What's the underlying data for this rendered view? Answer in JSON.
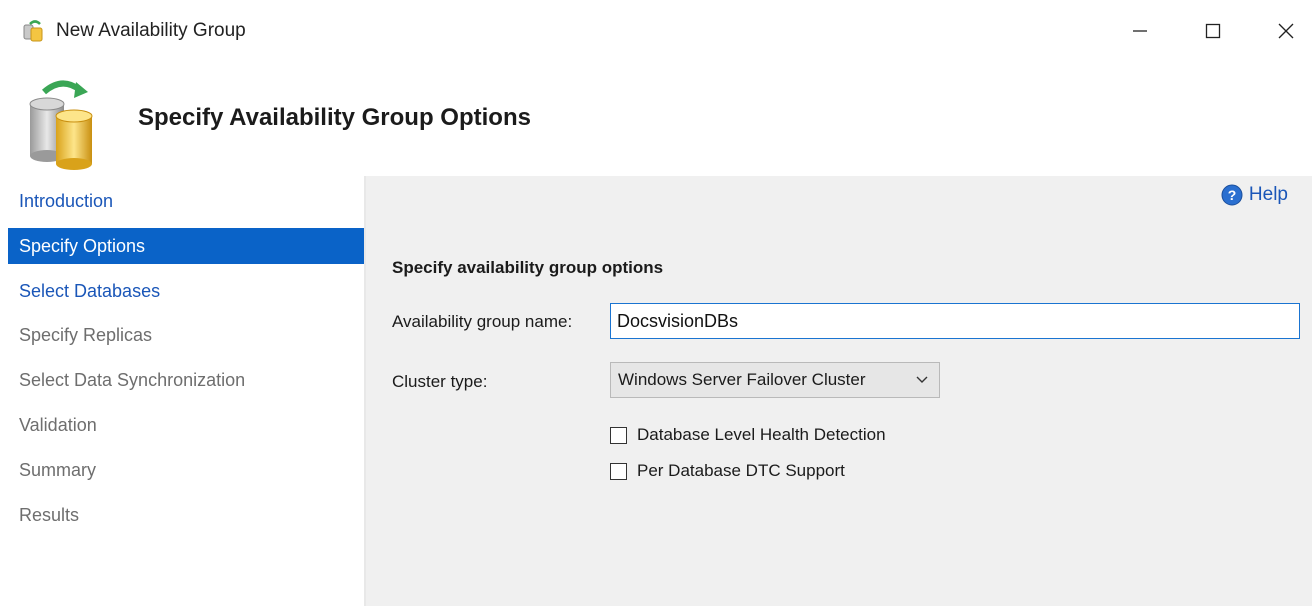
{
  "window": {
    "title": "New Availability Group"
  },
  "header": {
    "title": "Specify Availability Group Options"
  },
  "sidebar": {
    "items": [
      {
        "label": "Introduction",
        "state": "link"
      },
      {
        "label": "Specify Options",
        "state": "active"
      },
      {
        "label": "Select Databases",
        "state": "link"
      },
      {
        "label": "Specify Replicas",
        "state": "disabled"
      },
      {
        "label": "Select Data Synchronization",
        "state": "disabled"
      },
      {
        "label": "Validation",
        "state": "disabled"
      },
      {
        "label": "Summary",
        "state": "disabled"
      },
      {
        "label": "Results",
        "state": "disabled"
      }
    ]
  },
  "main": {
    "help_label": "Help",
    "section_title": "Specify availability group options",
    "name_label": "Availability group name:",
    "name_value": "DocsvisionDBs",
    "cluster_label": "Cluster type:",
    "cluster_value": "Windows Server Failover Cluster",
    "checkboxes": [
      {
        "label": "Database Level Health Detection",
        "checked": false
      },
      {
        "label": "Per Database DTC Support",
        "checked": false
      }
    ]
  },
  "colors": {
    "accent": "#0a63c8",
    "link": "#1a56b8",
    "panel_bg": "#f0f0f0"
  }
}
